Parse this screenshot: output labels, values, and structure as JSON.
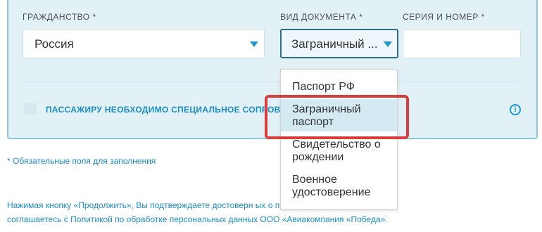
{
  "form": {
    "citizenship_label": "ГРАЖДАНСТВО *",
    "citizenship_value": "Россия",
    "doc_type_label": "ВИД ДОКУМЕНТА *",
    "doc_type_value": "Заграничный ...",
    "series_label": "СЕРИЯ И НОМЕР *",
    "series_value": ""
  },
  "special_assistance_label": "ПАССАЖИРУ НЕОБХОДИМО СПЕЦИАЛЬНОЕ СОПРОВО",
  "info_icon_glyph": "i",
  "required_note": "* Обязательные поля для заполнения",
  "consent": {
    "line1": "Нажимая кнопку «Продолжить», Вы подтверждаете достоверн                          ых о пассажирах и",
    "line2": "соглашаетесь с Политикой по обработке персональных данных ООО «Авиакомпания «Победа»."
  },
  "dropdown": {
    "options": [
      "Паспорт РФ",
      "Заграничный паспорт",
      "Свидетельство о рождении",
      "Военное удостоверение"
    ],
    "selected_index": 1
  },
  "colors": {
    "accent": "#1c8cc7",
    "panel_bg": "#e2f1f6",
    "highlight": "#d83c3c"
  }
}
